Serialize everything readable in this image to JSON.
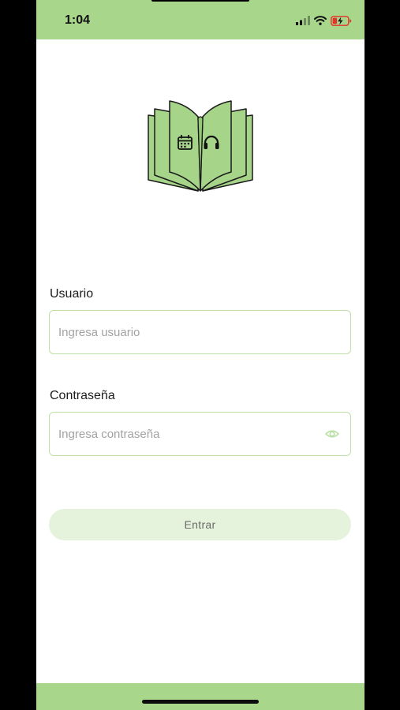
{
  "status_bar": {
    "time": "1:04",
    "icons": [
      "signal-icon",
      "wifi-icon",
      "battery-charging-icon"
    ]
  },
  "logo": {
    "icon": "open-book-icon",
    "page_icons": [
      "calendar-icon",
      "headphones-icon"
    ]
  },
  "form": {
    "username": {
      "label": "Usuario",
      "placeholder": "Ingresa usuario",
      "value": ""
    },
    "password": {
      "label": "Contraseña",
      "placeholder": "Ingresa contraseña",
      "value": "",
      "toggle_icon": "eye-icon"
    },
    "submit_label": "Entrar"
  },
  "colors": {
    "accent": "#a8d68a",
    "logo_fill": "#a6d58a",
    "input_border": "#bde0a8",
    "button_bg": "#e6f3dc",
    "battery_charging": "#e2342b"
  }
}
